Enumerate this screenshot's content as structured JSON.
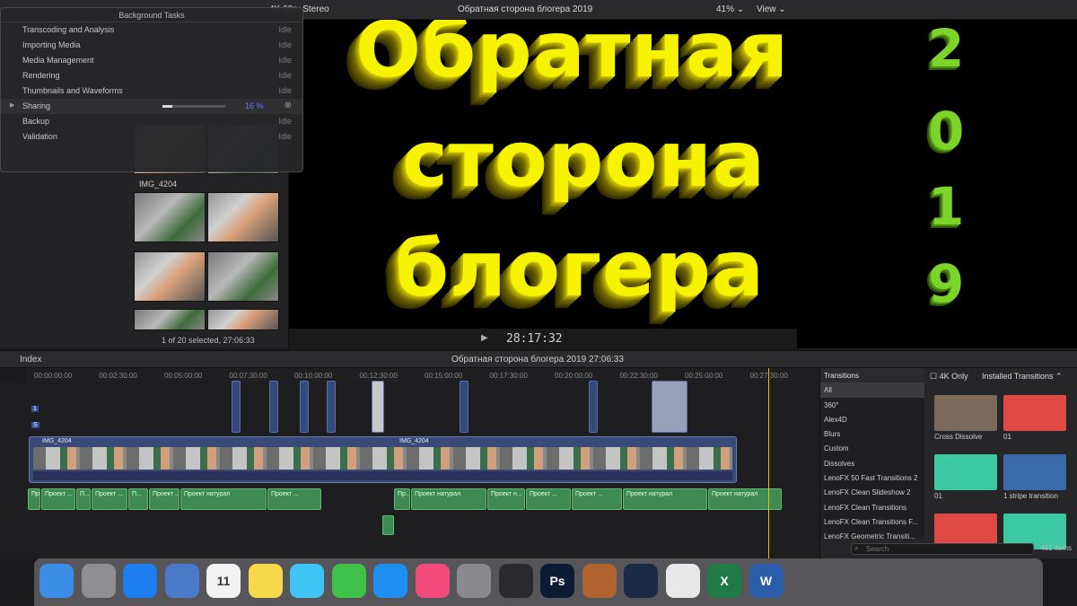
{
  "topbar": {
    "clip_info": "4K 60p, Stereo",
    "project_name": "Обратная сторона блогера 2019",
    "zoom": "41%",
    "view_menu": "View"
  },
  "title_overlay": {
    "line1": "Обратная",
    "line2": "сторона",
    "line3": "блогера",
    "year_digits": [
      "2",
      "0",
      "1",
      "9"
    ]
  },
  "background_tasks": {
    "title": "Background Tasks",
    "tasks": [
      {
        "name": "Transcoding and Analysis",
        "status": "Idle"
      },
      {
        "name": "Importing Media",
        "status": "Idle"
      },
      {
        "name": "Media Management",
        "status": "Idle"
      },
      {
        "name": "Rendering",
        "status": "Idle"
      },
      {
        "name": "Thumbnails and Waveforms",
        "status": "Idle"
      },
      {
        "name": "Sharing",
        "status": "16 %",
        "progress": 0.16
      },
      {
        "name": "Backup",
        "status": "Idle"
      },
      {
        "name": "Validation",
        "status": "Idle"
      }
    ]
  },
  "browser": {
    "clip_label": "IMG_4204",
    "selection_info": "1 of 20 selected, 27:06:33"
  },
  "viewer": {
    "timecode": "28:17:32"
  },
  "timeline": {
    "index_label": "Index",
    "project_name": "Обратная сторона блогера 2019",
    "duration": "27:06:33",
    "ruler": [
      "00:00:00:00",
      "00:02:30:00",
      "00:05:00:00",
      "00:07:30:00",
      "00:10:00:00",
      "00:12:30:00",
      "00:15:00:00",
      "00:17:30:00",
      "00:20:00:00",
      "00:22:30:00",
      "00:25:00:00",
      "00:27:30:00"
    ],
    "primary_clip_a": "IMG_4204",
    "primary_clip_b": "IMG_4204",
    "audio_clips": [
      "Проект...",
      "Проект ...",
      "П...",
      "Проект ...",
      "П...",
      "Проект ...",
      "Проект натурал",
      "Проект ...",
      "Пр...",
      "Проект натурал",
      "Проект н...",
      "Проект ...",
      "Проект ...",
      "Проект натурал",
      "Проект натурал"
    ],
    "lane_markers": [
      "1",
      "S"
    ]
  },
  "transitions": {
    "header": "Transitions",
    "categories": [
      "All",
      "360°",
      "Alex4D",
      "Blurs",
      "Custom",
      "Dissolves",
      "LenoFX 50 Fast Transitions 2",
      "LenoFX Clean Slideshow 2",
      "LenoFX Clean Transitions",
      "LenoFX Clean Transitions F...",
      "LenoFX Geometric Transiti..."
    ],
    "only_4k_label": "4K Only",
    "filter_label": "Installed Transitions",
    "tiles": [
      {
        "label": "Cross Dissolve",
        "color": "#7b6a5c"
      },
      {
        "label": "01",
        "color": "#e04a45"
      },
      {
        "label": "01",
        "color": "#3cc9a2"
      },
      {
        "label": "1 stripe transition",
        "color": "#3a6aa8"
      },
      {
        "label": "",
        "color": "#e04a45"
      },
      {
        "label": "",
        "color": "#3cc9a2"
      }
    ],
    "search_placeholder": "Search",
    "item_count": "461 items"
  },
  "dock": {
    "apps": [
      {
        "name": "Finder",
        "color": "#3a8ee6"
      },
      {
        "name": "Launchpad",
        "color": "#8e8e93"
      },
      {
        "name": "Safari",
        "color": "#1e7ef0"
      },
      {
        "name": "Mail",
        "color": "#4a7ac8"
      },
      {
        "name": "Calendar",
        "color": "#f2f2f2",
        "label": "11"
      },
      {
        "name": "Notes",
        "color": "#f6d94a"
      },
      {
        "name": "Messages",
        "color": "#3ec5f5"
      },
      {
        "name": "FaceTime",
        "color": "#3fc24b"
      },
      {
        "name": "App Store",
        "color": "#1f8ef1"
      },
      {
        "name": "iTunes",
        "color": "#f24a7c"
      },
      {
        "name": "System Preferences",
        "color": "#8a8a8e"
      },
      {
        "name": "Final Cut Pro",
        "color": "#2a2a2e"
      },
      {
        "name": "Photoshop",
        "color": "#0b1b33",
        "label": "Ps"
      },
      {
        "name": "Compressor",
        "color": "#b0632e"
      },
      {
        "name": "QuickTime",
        "color": "#1a2a44"
      },
      {
        "name": "Chrome",
        "color": "#e8e8e8"
      },
      {
        "name": "Excel",
        "color": "#1f7a45",
        "label": "X"
      },
      {
        "name": "Word",
        "color": "#2a5caa",
        "label": "W"
      }
    ]
  }
}
